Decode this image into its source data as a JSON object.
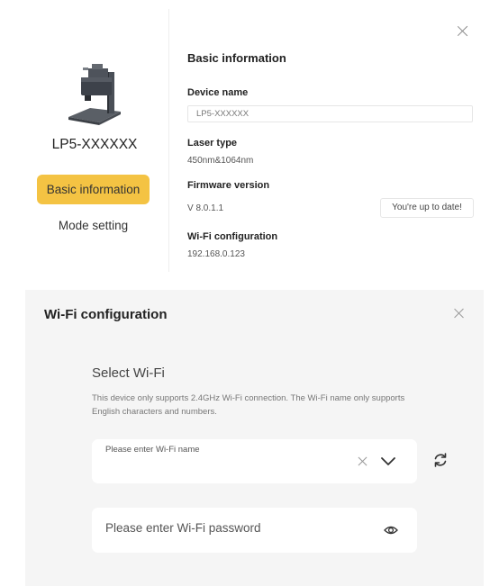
{
  "device_dialog": {
    "device_title": "LP5-XXXXXX",
    "nav": {
      "basic_information": "Basic information",
      "mode_setting": "Mode setting"
    },
    "section_title": "Basic information",
    "fields": {
      "device_name_label": "Device name",
      "device_name_value": "LP5-XXXXXX",
      "laser_type_label": "Laser type",
      "laser_type_value": "450nm&1064nm",
      "firmware_label": "Firmware version",
      "firmware_value": "V 8.0.1.1",
      "firmware_status": "You're up to date!",
      "wifi_label": "Wi-Fi configuration",
      "wifi_value": "192.168.0.123"
    },
    "accent_color": "#f4c343"
  },
  "wifi_dialog": {
    "title": "Wi-Fi configuration",
    "select_title": "Select Wi-Fi",
    "description": "This device only supports 2.4GHz Wi-Fi connection. The Wi-Fi name only supports English characters and numbers.",
    "ssid_placeholder": "Please enter Wi-Fi name",
    "password_placeholder": "Please enter Wi-Fi password",
    "icons": [
      "close-icon",
      "chevron-down-icon",
      "refresh-icon",
      "eye-icon"
    ]
  }
}
